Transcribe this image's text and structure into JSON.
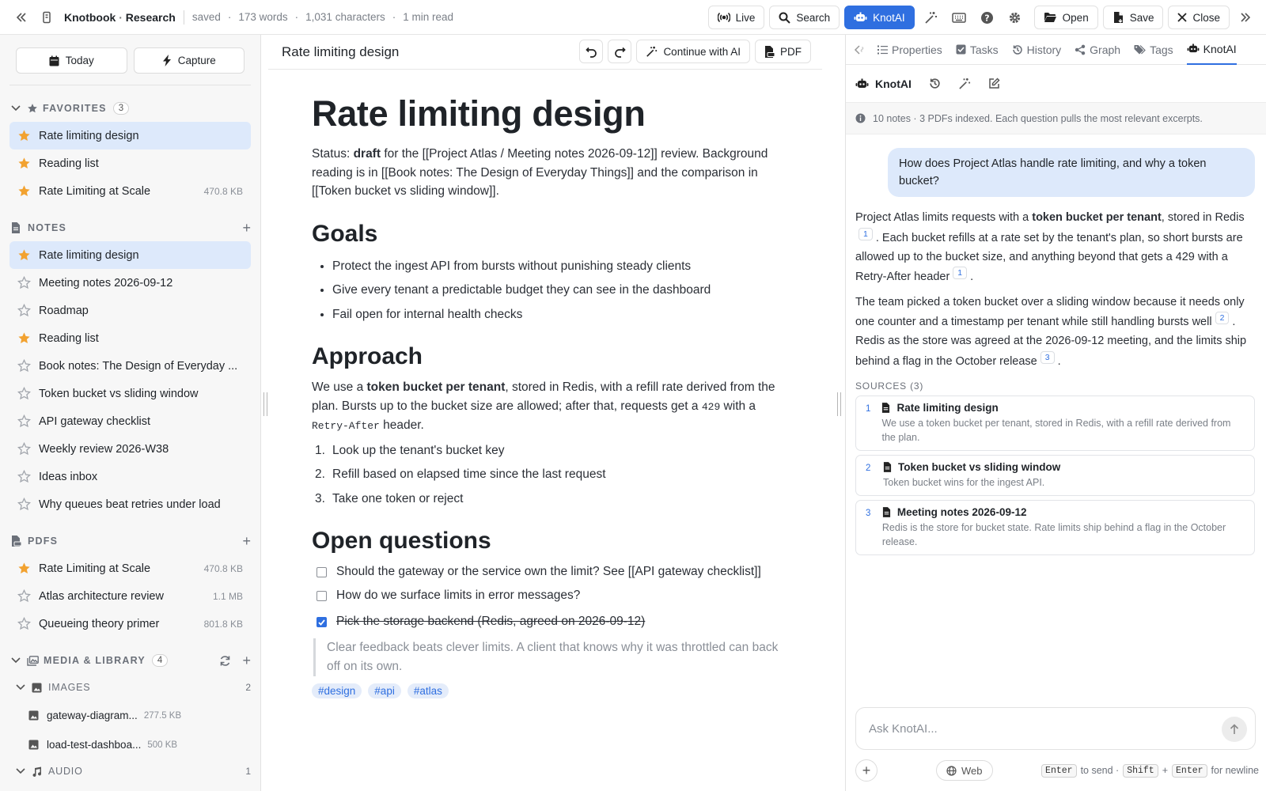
{
  "app": {
    "name": "Knotbook",
    "vault": "Research",
    "title_sep": "·"
  },
  "status": {
    "saved": "saved",
    "words": "173 words",
    "chars": "1,031 characters",
    "read": "1 min read",
    "dot": "·"
  },
  "toolbar": {
    "live": "Live",
    "search": "Search",
    "knotai": "KnotAI",
    "open": "Open",
    "save": "Save",
    "close": "Close"
  },
  "sidebar": {
    "today": "Today",
    "capture": "Capture",
    "favorites": {
      "label": "FAVORITES",
      "count": "3",
      "items": [
        {
          "label": "Rate limiting design",
          "size": ""
        },
        {
          "label": "Reading list",
          "size": ""
        },
        {
          "label": "Rate Limiting at Scale",
          "size": "470.8 KB"
        }
      ]
    },
    "notes": {
      "label": "NOTES",
      "items": [
        {
          "label": "Rate limiting design",
          "starred": true
        },
        {
          "label": "Meeting notes 2026-09-12",
          "starred": false
        },
        {
          "label": "Roadmap",
          "starred": false
        },
        {
          "label": "Reading list",
          "starred": true
        },
        {
          "label": "Book notes: The Design of Everyday ...",
          "starred": false
        },
        {
          "label": "Token bucket vs sliding window",
          "starred": false
        },
        {
          "label": "API gateway checklist",
          "starred": false
        },
        {
          "label": "Weekly review 2026-W38",
          "starred": false
        },
        {
          "label": "Ideas inbox",
          "starred": false
        },
        {
          "label": "Why queues beat retries under load",
          "starred": false
        }
      ]
    },
    "pdfs": {
      "label": "PDFS",
      "items": [
        {
          "label": "Rate Limiting at Scale",
          "size": "470.8 KB"
        },
        {
          "label": "Atlas architecture review",
          "size": "1.1 MB"
        },
        {
          "label": "Queueing theory primer",
          "size": "801.8 KB"
        }
      ]
    },
    "media": {
      "label": "MEDIA & LIBRARY",
      "count": "4"
    },
    "images": {
      "label": "IMAGES",
      "count": "2",
      "items": [
        {
          "label": "gateway-diagram...",
          "size": "277.5 KB"
        },
        {
          "label": "load-test-dashboa...",
          "size": "500 KB"
        }
      ]
    },
    "audio": {
      "label": "AUDIO",
      "count": "1"
    }
  },
  "editor": {
    "tab_title": "Rate limiting design",
    "continue": "Continue with AI",
    "pdf": "PDF",
    "h1": "Rate limiting design",
    "intro": {
      "a": "Status: ",
      "b": "draft",
      "c": " for the [[Project Atlas / Meeting notes 2026-09-12]] review. Background reading is in [[Book notes: The Design of Everyday Things]] and the comparison in [[Token bucket vs sliding window]]."
    },
    "goals_h": "Goals",
    "goals": [
      "Protect the ingest API from bursts without punishing steady clients",
      "Give every tenant a predictable budget they can see in the dashboard",
      "Fail open for internal health checks"
    ],
    "approach_h": "Approach",
    "approach": {
      "a": "We use a ",
      "b": "token bucket per tenant",
      "c": ", stored in Redis, with a refill rate derived from the plan. Bursts up to the bucket size are allowed; after that, requests get a ",
      "code1": "429",
      "d": " with a ",
      "code2": "Retry-After",
      "e": " header."
    },
    "steps": [
      {
        "n": "1.",
        "t": "Look up the tenant's bucket key"
      },
      {
        "n": "2.",
        "t": "Refill based on elapsed time since the last request"
      },
      {
        "n": "3.",
        "t": "Take one token or reject"
      }
    ],
    "open_h": "Open questions",
    "tasks": [
      {
        "t": "Should the gateway or the service own the limit? See [[API gateway checklist]]",
        "done": false
      },
      {
        "t": "How do we surface limits in error messages?",
        "done": false
      },
      {
        "t": "Pick the storage backend (Redis, agreed on 2026-09-12)",
        "done": true
      }
    ],
    "quote": "Clear feedback beats clever limits. A client that knows why it was throttled can back off on its own.",
    "tags": [
      "#design",
      "#api",
      "#atlas"
    ]
  },
  "panel": {
    "tabs": [
      "Properties",
      "Tasks",
      "History",
      "Graph",
      "Tags",
      "KnotAI"
    ],
    "title": "KnotAI",
    "info": "10 notes · 3 PDFs indexed. Each question pulls the most relevant excerpts.",
    "question": "How does Project Atlas handle rate limiting, and why a token bucket?",
    "answer1": {
      "a": "Project Atlas limits requests with a ",
      "b": "token bucket per tenant",
      "c": ", stored in Redis",
      "c1": "1",
      "d": ". Each bucket refills at a rate set by the tenant's plan, so short bursts are allowed up to the bucket size, and anything beyond that gets a 429 with a Retry-After header",
      "c2": "1",
      "e": "."
    },
    "answer2": {
      "a": "The team picked a token bucket over a sliding window because it needs only one counter and a timestamp per tenant while still handling bursts well",
      "c1": "2",
      "b": ". Redis as the store was agreed at the 2026-09-12 meeting, and the limits ship behind a flag in the October release",
      "c2": "3",
      "c": "."
    },
    "sources_label": "SOURCES (3)",
    "sources": [
      {
        "n": "1",
        "title": "Rate limiting design",
        "text": "We use a token bucket per tenant, stored in Redis, with a refill rate derived from the plan."
      },
      {
        "n": "2",
        "title": "Token bucket vs sliding window",
        "text": "Token bucket wins for the ingest API."
      },
      {
        "n": "3",
        "title": "Meeting notes 2026-09-12",
        "text": "Redis is the store for bucket state. Rate limits ship behind a flag in the October release."
      }
    ],
    "placeholder": "Ask KnotAI...",
    "web": "Web",
    "hint": {
      "k1": "Enter",
      "t1": "to send ·",
      "k2": "Shift",
      "plus": "+",
      "k3": "Enter",
      "t2": "for newline"
    }
  }
}
